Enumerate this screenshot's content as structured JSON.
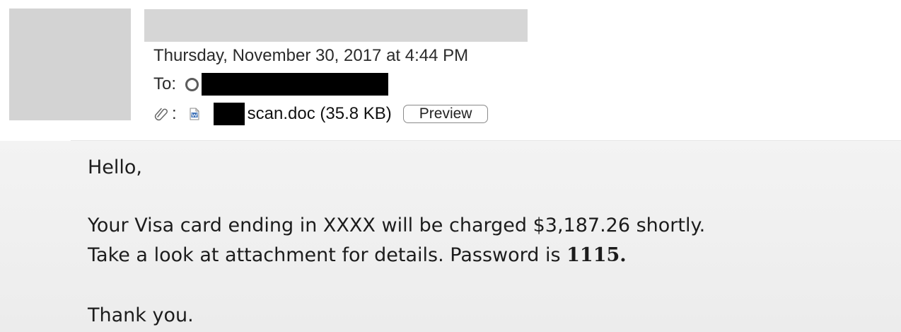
{
  "header": {
    "date": "Thursday, November 30, 2017 at 4:44 PM",
    "to_label": "To:",
    "attachment": {
      "separator": ":",
      "filename": "scan.doc (35.8 KB)",
      "preview_label": "Preview"
    }
  },
  "body": {
    "greeting": "Hello,",
    "line1": "Your Visa card ending in XXXX will be charged $3,187.26 shortly.",
    "line2_prefix": "Take a look at attachment for details. Password is ",
    "password": "1115",
    "line2_suffix": ".",
    "signoff": "Thank you."
  },
  "icons": {
    "attachment": "paperclip-icon",
    "file": "word-document-icon",
    "recipient_status": "status-ring-icon"
  },
  "colors": {
    "body_background": "#efefef",
    "avatar_placeholder": "#d3d3d3",
    "redaction": "#000000"
  }
}
